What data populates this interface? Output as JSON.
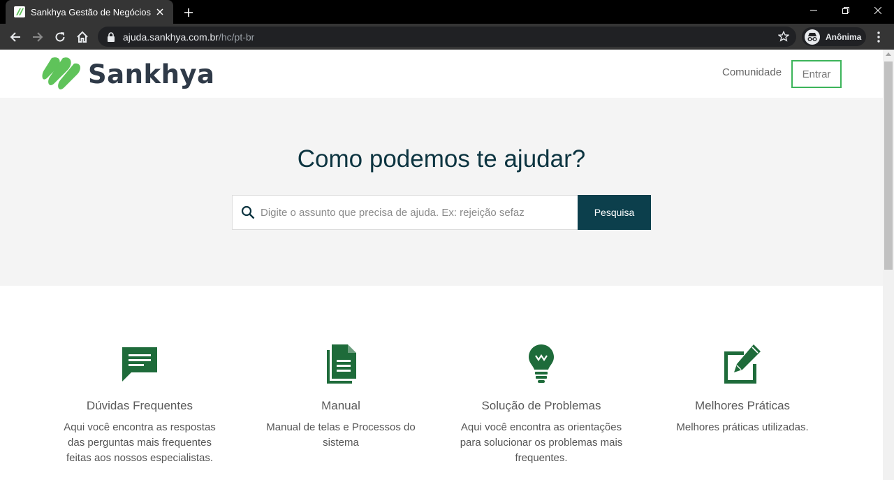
{
  "browser": {
    "tab_title": "Sankhya Gestão de Negócios",
    "url_host": "ajuda.sankhya.com.br",
    "url_path": "/hc/pt-br",
    "profile_label": "Anônima"
  },
  "header": {
    "logo_text": "Sankhya",
    "nav_community": "Comunidade",
    "nav_login": "Entrar"
  },
  "hero": {
    "title": "Como podemos te ajudar?",
    "search_placeholder": "Digite o assunto que precisa de ajuda. Ex: rejeição sefaz",
    "search_value": "",
    "search_button": "Pesquisa"
  },
  "categories": [
    {
      "icon": "chat-icon",
      "title": "Dúvidas Frequentes",
      "description": "Aqui você encontra as respostas das perguntas mais frequentes feitas aos nossos especialistas."
    },
    {
      "icon": "document-icon",
      "title": "Manual",
      "description": "Manual de telas e Processos do sistema"
    },
    {
      "icon": "lightbulb-icon",
      "title": "Solução de Problemas",
      "description": "Aqui você encontra as orientações para solucionar os problemas mais frequentes."
    },
    {
      "icon": "edit-icon",
      "title": "Melhores Práticas",
      "description": "Melhores práticas utilizadas."
    }
  ],
  "colors": {
    "brand_green": "#1e6b3a",
    "logo_green": "#5fc35a",
    "accent_dark": "#0c3f4c",
    "login_border": "#3cb45a"
  }
}
